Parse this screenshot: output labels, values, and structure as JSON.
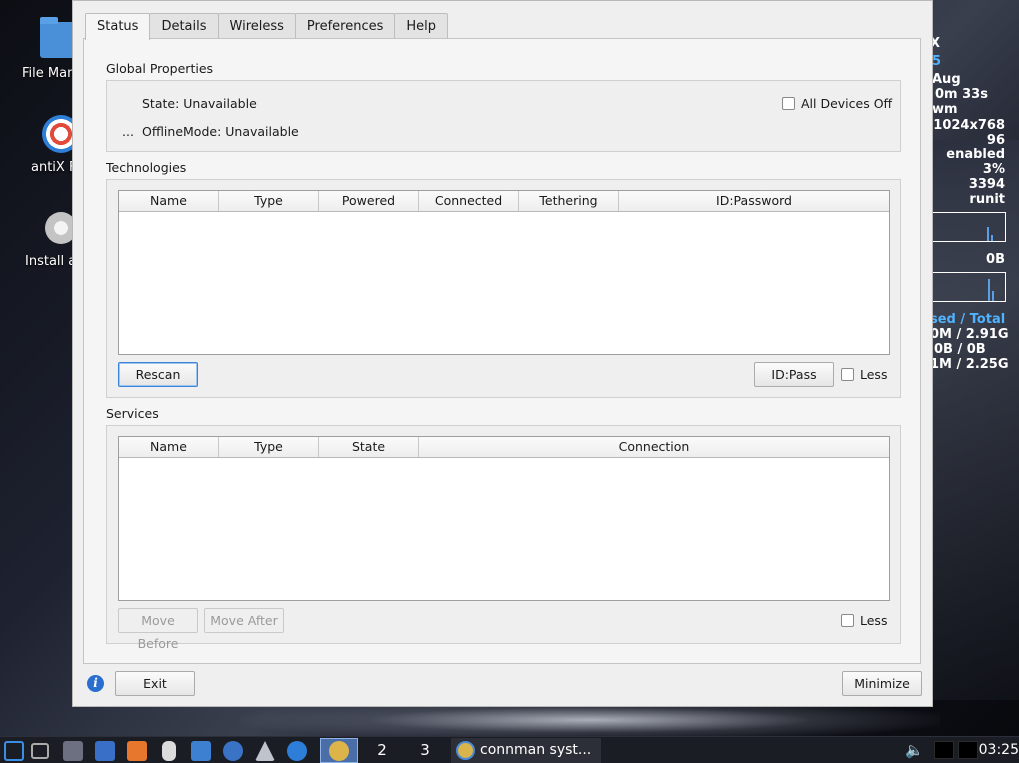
{
  "desktop": {
    "icons": [
      {
        "label": "File Man",
        "icon": "folder-icon"
      },
      {
        "label": "antiX F",
        "icon": "lifebuoy-icon"
      },
      {
        "label": "Install a",
        "icon": "disc-icon"
      }
    ],
    "conky": {
      "lines": [
        "X",
        "5",
        "Aug",
        "0m 33s",
        "wm",
        "1024x768",
        "96",
        "enabled",
        "3%",
        "3394",
        "runit",
        "0B",
        "sed / Total",
        "0M  / 2.91G",
        "0B   / 0B",
        "1M / 2.25G"
      ]
    }
  },
  "window": {
    "tabs": [
      "Status",
      "Details",
      "Wireless",
      "Preferences",
      "Help"
    ],
    "active_tab": "Status",
    "global_properties": {
      "title": "Global Properties",
      "state": "State: Unavailable",
      "offline_prefix": "...",
      "offline_mode": "OfflineMode: Unavailable",
      "all_devices_off": "All Devices Off",
      "all_devices_off_checked": false
    },
    "technologies": {
      "title": "Technologies",
      "columns": [
        "Name",
        "Type",
        "Powered",
        "Connected",
        "Tethering",
        "ID:Password"
      ],
      "rows": [],
      "rescan_label": "Rescan",
      "idpass_label": "ID:Pass",
      "less_label": "Less",
      "less_checked": false
    },
    "services": {
      "title": "Services",
      "columns": [
        "Name",
        "Type",
        "State",
        "Connection"
      ],
      "rows": [],
      "move_before_label": "Move Before",
      "move_after_label": "Move After",
      "less_label": "Less",
      "less_checked": false
    },
    "footer": {
      "exit_label": "Exit",
      "minimize_label": "Minimize"
    }
  },
  "taskbar": {
    "workspaces": [
      "2",
      "3"
    ],
    "task_title": "connman syst...",
    "clock": "03:25"
  }
}
